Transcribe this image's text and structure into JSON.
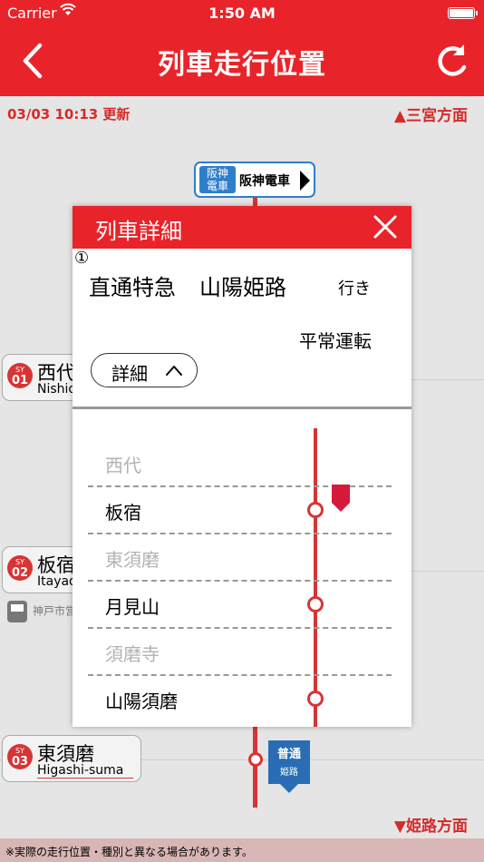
{
  "status_bar": {
    "carrier": "Carrier",
    "time": "1:50 AM"
  },
  "nav": {
    "title": "列車走行位置",
    "back_icon": "chevron-left-icon",
    "refresh_icon": "refresh-icon"
  },
  "info": {
    "updated": "03/03 10:13 更新",
    "direction_up": "▲三宮方面",
    "direction_down": "▼姫路方面"
  },
  "hanshin": {
    "logo_line1": "阪神",
    "logo_line2": "電車",
    "name": "阪神電車"
  },
  "stations": [
    {
      "code": "SY",
      "num": "01",
      "jp": "西代",
      "en": "Nishidai"
    },
    {
      "code": "SY",
      "num": "02",
      "jp": "板宿",
      "en": "Itayado"
    },
    {
      "code": "SY",
      "num": "03",
      "jp": "東須磨",
      "en": "Higashi-suma"
    }
  ],
  "subway_label": "神戸市営",
  "train_badge": {
    "type": "普通",
    "dest": "姫路"
  },
  "footer": "※実際の走行位置・種別と異なる場合があります。",
  "modal": {
    "title": "列車詳細",
    "circled_number": "①",
    "train_type": "直通特急",
    "destination": "山陽姫路",
    "bound": "行き",
    "status": "平常運転",
    "detail_button": "詳細",
    "route": [
      {
        "name": "西代",
        "stop": false
      },
      {
        "name": "板宿",
        "stop": true
      },
      {
        "name": "東須磨",
        "stop": false
      },
      {
        "name": "月見山",
        "stop": true
      },
      {
        "name": "須磨寺",
        "stop": false
      },
      {
        "name": "山陽須磨",
        "stop": true
      }
    ]
  },
  "colors": {
    "accent": "#e8242a",
    "line": "#d63535",
    "badge_blue": "#2a6db4"
  }
}
